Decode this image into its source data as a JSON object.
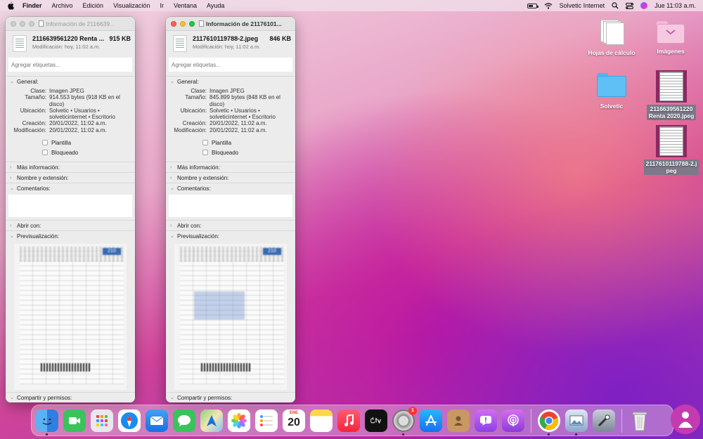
{
  "menubar": {
    "app": "Finder",
    "items": [
      "Archivo",
      "Edición",
      "Visualización",
      "Ir",
      "Ventana",
      "Ayuda"
    ],
    "network": "Solvetic Internet",
    "clock": "Jue 11:03 a.m.",
    "battery_level": 0.6
  },
  "windows": [
    {
      "title": "Información de 2116639...",
      "file_name": "2116639561220 Renta ...",
      "file_size": "915 KB",
      "modified": "Modificación: hoy, 11:02 a.m.",
      "tags_placeholder": "Agregar etiquetas...",
      "general": {
        "header": "General:",
        "kind_label": "Clase:",
        "kind": "Imagen JPEG",
        "size_label": "Tamaño:",
        "size": "914.553 bytes (918 KB en el disco)",
        "where_label": "Ubicación:",
        "where": "Solvetic • Usuarios • solveticinternet • Escritorio",
        "created_label": "Creación:",
        "created": "20/01/2022, 11:02 a.m.",
        "modified_label": "Modificación:",
        "modified": "20/01/2022, 11:02 a.m.",
        "stationery": "Plantilla",
        "locked": "Bloqueado"
      },
      "sections": {
        "more_info": "Más información:",
        "name_ext": "Nombre y extensión:",
        "comments": "Comentarios:",
        "open_with": "Abrir con:",
        "preview": "Previsualización:",
        "sharing": "Compartir y permisos:"
      },
      "preview_number": "210"
    },
    {
      "title": "Información de 21176101...",
      "file_name": "2117610119788-2.jpeg",
      "file_size": "846 KB",
      "modified": "Modificación: hoy, 11:02 a.m.",
      "tags_placeholder": "Agregar etiquetas...",
      "general": {
        "header": "General:",
        "kind_label": "Clase:",
        "kind": "Imagen JPEG",
        "size_label": "Tamaño:",
        "size": "845.899 bytes (848 KB en el disco)",
        "where_label": "Ubicación:",
        "where": "Solvetic • Usuarios • solveticinternet • Escritorio",
        "created_label": "Creación:",
        "created": "20/01/2022, 11:02 a.m.",
        "modified_label": "Modificación:",
        "modified": "20/01/2022, 11:02 a.m.",
        "stationery": "Plantilla",
        "locked": "Bloqueado"
      },
      "sections": {
        "more_info": "Más información:",
        "name_ext": "Nombre y extensión:",
        "comments": "Comentarios:",
        "open_with": "Abrir con:",
        "preview": "Previsualización:",
        "sharing": "Compartir y permisos:"
      },
      "preview_number": "210"
    }
  ],
  "desktop": {
    "spreadsheets": "Hojas de cálculo",
    "images": "Imágenes",
    "folder": "Solvetic",
    "file1_line1": "2116639561220",
    "file1_line2": "Renta 2020.jpeg",
    "file2_line1": "2117610119788-2.j",
    "file2_line2": "peg"
  },
  "dock": {
    "calendar_month": "ENE",
    "calendar_day": "20",
    "settings_badge": "1",
    "items": [
      "Finder",
      "FaceTime",
      "Launchpad",
      "Safari",
      "Mail",
      "Mensajes",
      "Mapas",
      "Fotos",
      "Recordatorios",
      "Calendario",
      "Notas",
      "Música",
      "TV",
      "Preferencias del Sistema",
      "App Store",
      "Contactos",
      "Feedback",
      "Podcasts",
      "Chrome",
      "Vista Previa",
      "Utilidad",
      "Papelera"
    ]
  },
  "colors": {
    "accent_blue": "#1a7cf0",
    "close_red": "#ff5f57",
    "minimize_yellow": "#febc2e",
    "zoom_green": "#28c840"
  }
}
